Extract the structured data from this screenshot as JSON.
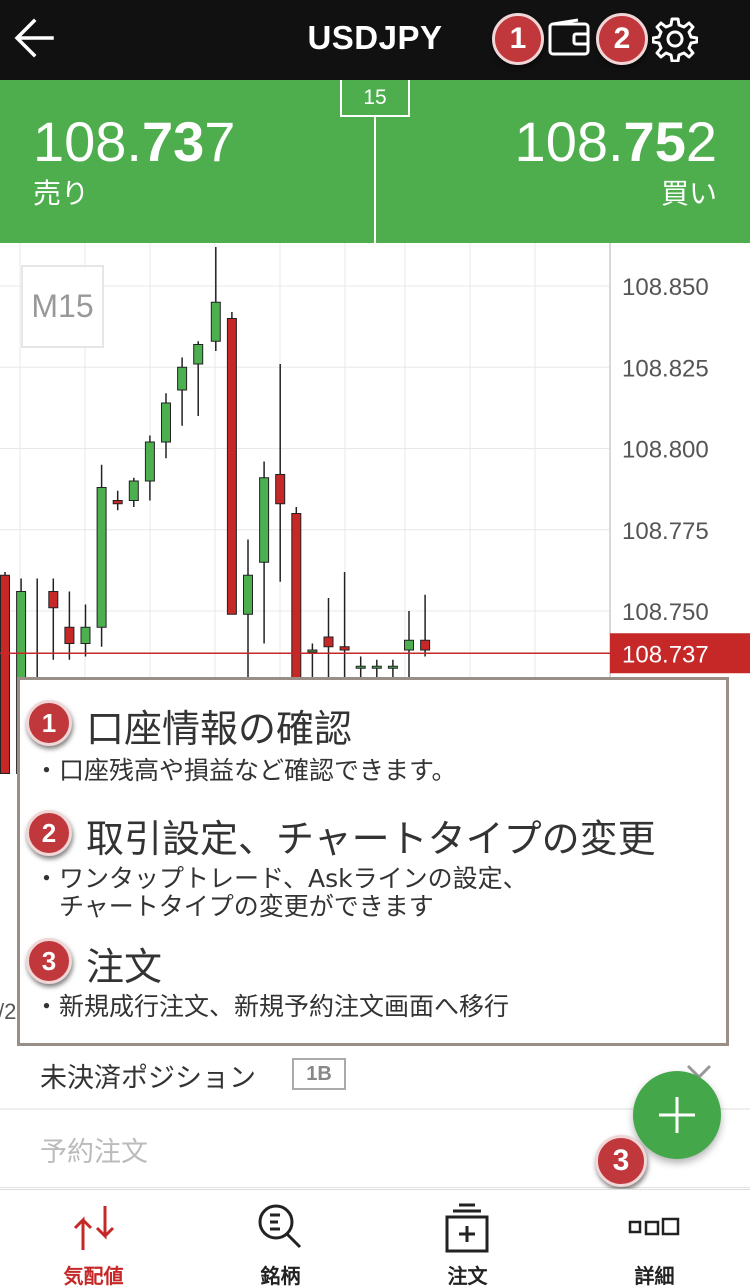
{
  "header": {
    "title": "USDJPY",
    "icons": [
      "back-arrow-icon",
      "wallet-icon",
      "gear-icon"
    ],
    "marker_1": "1",
    "marker_2": "2"
  },
  "quote": {
    "spread": "15",
    "sell": {
      "price_pre": "108.",
      "price_big": "73",
      "price_post": "7",
      "label": "売り"
    },
    "buy": {
      "price_pre": "108.",
      "price_big": "75",
      "price_post": "2",
      "label": "買い"
    },
    "color": "#4eae4e"
  },
  "chart": {
    "timeframe": "M15",
    "current_price_label": "108.737",
    "date_fragment": "/2",
    "colors": {
      "up": "#4caf50",
      "down": "#c62828",
      "grid": "#e8e8e8",
      "price_line": "#c62828"
    }
  },
  "chart_data": {
    "type": "candlestick",
    "ylim": [
      108.7,
      108.862
    ],
    "yticks": [
      "108.850",
      "108.825",
      "108.800",
      "108.775",
      "108.750"
    ],
    "current_price": 108.737,
    "candles": [
      {
        "o": 108.761,
        "h": 108.762,
        "l": 108.7,
        "c": 108.7
      },
      {
        "o": 108.7,
        "h": 108.76,
        "l": 108.7,
        "c": 108.756
      },
      {
        "o": 108.7,
        "h": 108.76,
        "l": 108.7,
        "c": 108.7
      },
      {
        "o": 108.756,
        "h": 108.76,
        "l": 108.735,
        "c": 108.751
      },
      {
        "o": 108.745,
        "h": 108.756,
        "l": 108.735,
        "c": 108.74
      },
      {
        "o": 108.74,
        "h": 108.752,
        "l": 108.736,
        "c": 108.745
      },
      {
        "o": 108.745,
        "h": 108.795,
        "l": 108.739,
        "c": 108.788
      },
      {
        "o": 108.784,
        "h": 108.787,
        "l": 108.781,
        "c": 108.783
      },
      {
        "o": 108.784,
        "h": 108.791,
        "l": 108.782,
        "c": 108.79
      },
      {
        "o": 108.79,
        "h": 108.804,
        "l": 108.784,
        "c": 108.802
      },
      {
        "o": 108.802,
        "h": 108.817,
        "l": 108.797,
        "c": 108.814
      },
      {
        "o": 108.818,
        "h": 108.828,
        "l": 108.807,
        "c": 108.825
      },
      {
        "o": 108.826,
        "h": 108.833,
        "l": 108.81,
        "c": 108.832
      },
      {
        "o": 108.833,
        "h": 108.862,
        "l": 108.83,
        "c": 108.845
      },
      {
        "o": 108.84,
        "h": 108.842,
        "l": 108.749,
        "c": 108.749
      },
      {
        "o": 108.749,
        "h": 108.772,
        "l": 108.7,
        "c": 108.761
      },
      {
        "o": 108.765,
        "h": 108.796,
        "l": 108.74,
        "c": 108.791
      },
      {
        "o": 108.792,
        "h": 108.826,
        "l": 108.759,
        "c": 108.783
      },
      {
        "o": 108.78,
        "h": 108.782,
        "l": 108.7,
        "c": 108.7
      },
      {
        "o": 108.738,
        "h": 108.74,
        "l": 108.7,
        "c": 108.738
      },
      {
        "o": 108.742,
        "h": 108.754,
        "l": 108.7,
        "c": 108.739
      },
      {
        "o": 108.739,
        "h": 108.762,
        "l": 108.7,
        "c": 108.738
      },
      {
        "o": 108.733,
        "h": 108.736,
        "l": 108.7,
        "c": 108.733
      },
      {
        "o": 108.733,
        "h": 108.735,
        "l": 108.7,
        "c": 108.733
      },
      {
        "o": 108.733,
        "h": 108.735,
        "l": 108.7,
        "c": 108.733
      },
      {
        "o": 108.738,
        "h": 108.75,
        "l": 108.7,
        "c": 108.741
      },
      {
        "o": 108.741,
        "h": 108.755,
        "l": 108.736,
        "c": 108.738
      }
    ]
  },
  "guide": {
    "items": [
      {
        "number": "1",
        "title": "口座情報の確認",
        "desc": [
          "・口座残高や損益など確認できます。"
        ]
      },
      {
        "number": "2",
        "title": "取引設定、チャートタイプの変更",
        "desc": [
          "・ワンタップトレード、Askラインの設定、",
          "　チャートタイプの変更ができます"
        ]
      },
      {
        "number": "3",
        "title": "注文",
        "desc": [
          "・新規成行注文、新規予約注文画面へ移行"
        ]
      }
    ]
  },
  "positions": {
    "open_label": "未決済ポジション",
    "badge": "1B",
    "orders_label": "予約注文",
    "fab_marker": "3"
  },
  "nav": {
    "items": [
      {
        "label": "気配値",
        "icon": "quote-arrows-icon",
        "active": true
      },
      {
        "label": "銘柄",
        "icon": "symbol-search-icon",
        "active": false
      },
      {
        "label": "注文",
        "icon": "order-add-icon",
        "active": false
      },
      {
        "label": "詳細",
        "icon": "detail-grid-icon",
        "active": false
      }
    ]
  }
}
